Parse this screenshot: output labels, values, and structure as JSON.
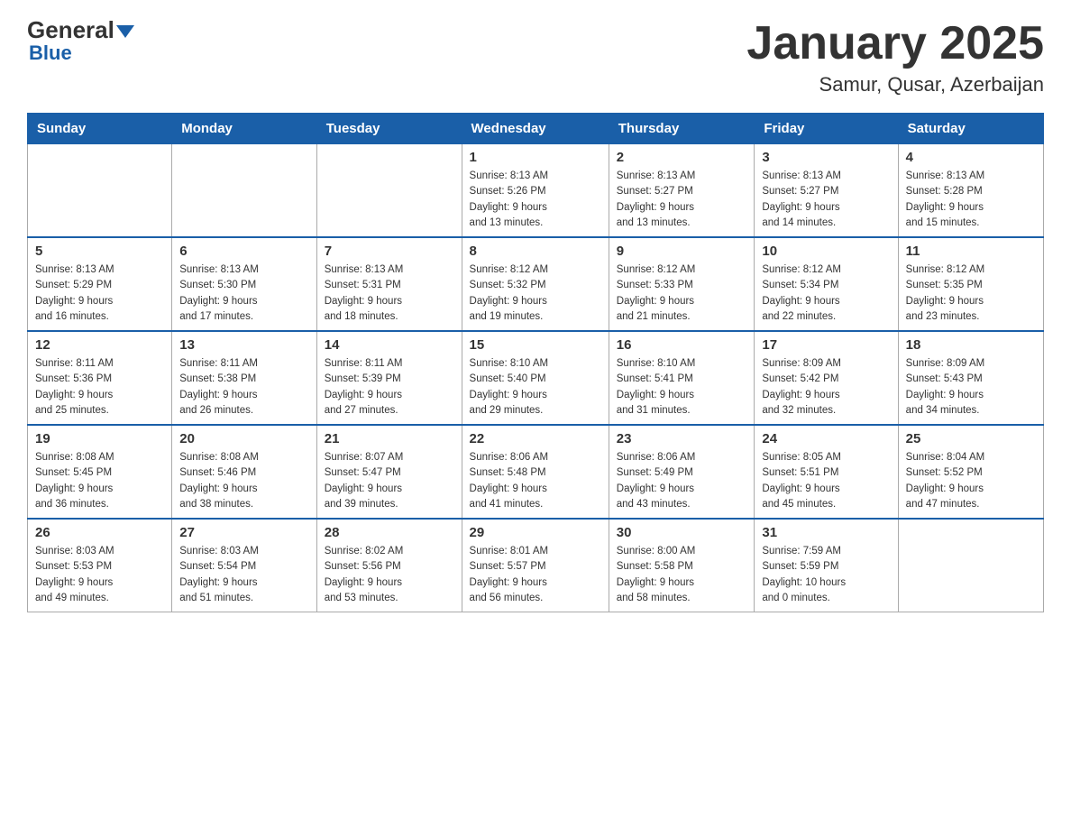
{
  "header": {
    "logo_general": "General",
    "logo_blue": "Blue",
    "title": "January 2025",
    "subtitle": "Samur, Qusar, Azerbaijan"
  },
  "days_of_week": [
    "Sunday",
    "Monday",
    "Tuesday",
    "Wednesday",
    "Thursday",
    "Friday",
    "Saturday"
  ],
  "weeks": [
    [
      {
        "day": "",
        "info": ""
      },
      {
        "day": "",
        "info": ""
      },
      {
        "day": "",
        "info": ""
      },
      {
        "day": "1",
        "info": "Sunrise: 8:13 AM\nSunset: 5:26 PM\nDaylight: 9 hours\nand 13 minutes."
      },
      {
        "day": "2",
        "info": "Sunrise: 8:13 AM\nSunset: 5:27 PM\nDaylight: 9 hours\nand 13 minutes."
      },
      {
        "day": "3",
        "info": "Sunrise: 8:13 AM\nSunset: 5:27 PM\nDaylight: 9 hours\nand 14 minutes."
      },
      {
        "day": "4",
        "info": "Sunrise: 8:13 AM\nSunset: 5:28 PM\nDaylight: 9 hours\nand 15 minutes."
      }
    ],
    [
      {
        "day": "5",
        "info": "Sunrise: 8:13 AM\nSunset: 5:29 PM\nDaylight: 9 hours\nand 16 minutes."
      },
      {
        "day": "6",
        "info": "Sunrise: 8:13 AM\nSunset: 5:30 PM\nDaylight: 9 hours\nand 17 minutes."
      },
      {
        "day": "7",
        "info": "Sunrise: 8:13 AM\nSunset: 5:31 PM\nDaylight: 9 hours\nand 18 minutes."
      },
      {
        "day": "8",
        "info": "Sunrise: 8:12 AM\nSunset: 5:32 PM\nDaylight: 9 hours\nand 19 minutes."
      },
      {
        "day": "9",
        "info": "Sunrise: 8:12 AM\nSunset: 5:33 PM\nDaylight: 9 hours\nand 21 minutes."
      },
      {
        "day": "10",
        "info": "Sunrise: 8:12 AM\nSunset: 5:34 PM\nDaylight: 9 hours\nand 22 minutes."
      },
      {
        "day": "11",
        "info": "Sunrise: 8:12 AM\nSunset: 5:35 PM\nDaylight: 9 hours\nand 23 minutes."
      }
    ],
    [
      {
        "day": "12",
        "info": "Sunrise: 8:11 AM\nSunset: 5:36 PM\nDaylight: 9 hours\nand 25 minutes."
      },
      {
        "day": "13",
        "info": "Sunrise: 8:11 AM\nSunset: 5:38 PM\nDaylight: 9 hours\nand 26 minutes."
      },
      {
        "day": "14",
        "info": "Sunrise: 8:11 AM\nSunset: 5:39 PM\nDaylight: 9 hours\nand 27 minutes."
      },
      {
        "day": "15",
        "info": "Sunrise: 8:10 AM\nSunset: 5:40 PM\nDaylight: 9 hours\nand 29 minutes."
      },
      {
        "day": "16",
        "info": "Sunrise: 8:10 AM\nSunset: 5:41 PM\nDaylight: 9 hours\nand 31 minutes."
      },
      {
        "day": "17",
        "info": "Sunrise: 8:09 AM\nSunset: 5:42 PM\nDaylight: 9 hours\nand 32 minutes."
      },
      {
        "day": "18",
        "info": "Sunrise: 8:09 AM\nSunset: 5:43 PM\nDaylight: 9 hours\nand 34 minutes."
      }
    ],
    [
      {
        "day": "19",
        "info": "Sunrise: 8:08 AM\nSunset: 5:45 PM\nDaylight: 9 hours\nand 36 minutes."
      },
      {
        "day": "20",
        "info": "Sunrise: 8:08 AM\nSunset: 5:46 PM\nDaylight: 9 hours\nand 38 minutes."
      },
      {
        "day": "21",
        "info": "Sunrise: 8:07 AM\nSunset: 5:47 PM\nDaylight: 9 hours\nand 39 minutes."
      },
      {
        "day": "22",
        "info": "Sunrise: 8:06 AM\nSunset: 5:48 PM\nDaylight: 9 hours\nand 41 minutes."
      },
      {
        "day": "23",
        "info": "Sunrise: 8:06 AM\nSunset: 5:49 PM\nDaylight: 9 hours\nand 43 minutes."
      },
      {
        "day": "24",
        "info": "Sunrise: 8:05 AM\nSunset: 5:51 PM\nDaylight: 9 hours\nand 45 minutes."
      },
      {
        "day": "25",
        "info": "Sunrise: 8:04 AM\nSunset: 5:52 PM\nDaylight: 9 hours\nand 47 minutes."
      }
    ],
    [
      {
        "day": "26",
        "info": "Sunrise: 8:03 AM\nSunset: 5:53 PM\nDaylight: 9 hours\nand 49 minutes."
      },
      {
        "day": "27",
        "info": "Sunrise: 8:03 AM\nSunset: 5:54 PM\nDaylight: 9 hours\nand 51 minutes."
      },
      {
        "day": "28",
        "info": "Sunrise: 8:02 AM\nSunset: 5:56 PM\nDaylight: 9 hours\nand 53 minutes."
      },
      {
        "day": "29",
        "info": "Sunrise: 8:01 AM\nSunset: 5:57 PM\nDaylight: 9 hours\nand 56 minutes."
      },
      {
        "day": "30",
        "info": "Sunrise: 8:00 AM\nSunset: 5:58 PM\nDaylight: 9 hours\nand 58 minutes."
      },
      {
        "day": "31",
        "info": "Sunrise: 7:59 AM\nSunset: 5:59 PM\nDaylight: 10 hours\nand 0 minutes."
      },
      {
        "day": "",
        "info": ""
      }
    ]
  ]
}
